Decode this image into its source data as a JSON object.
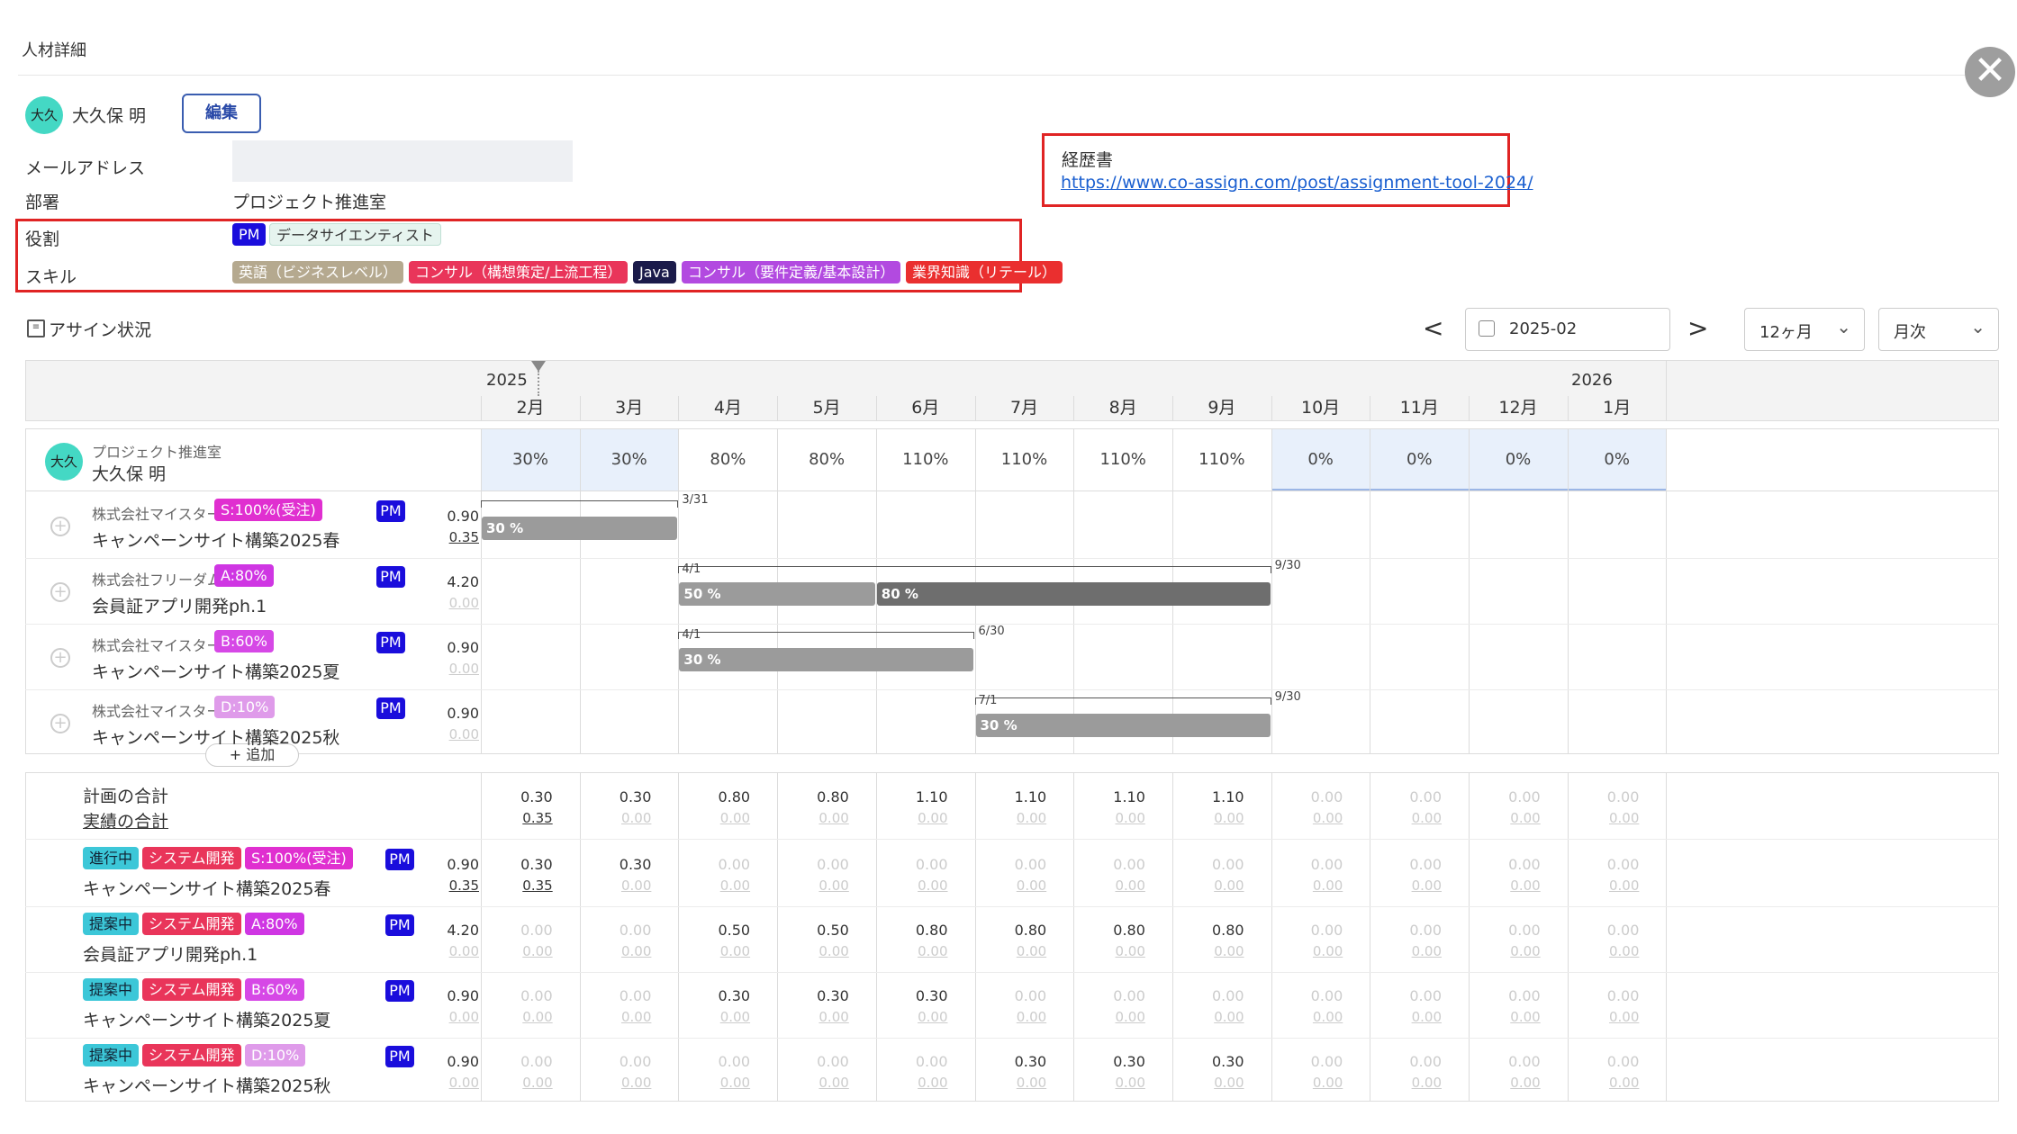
{
  "header": {
    "title": "人材詳細",
    "close_icon": "close-circle-icon"
  },
  "person": {
    "avatar": "大久",
    "name": "大久保 明",
    "edit_label": "編集"
  },
  "fields": {
    "email_label": "メールアドレス",
    "email_value": "",
    "dept_label": "部署",
    "dept_value": "プロジェクト推進室",
    "role_label": "役割",
    "skill_label": "スキル"
  },
  "roles": [
    {
      "label": "PM",
      "color": "#1a0ddc"
    },
    {
      "label": "データサイエンティスト",
      "color": "#e6f4ef"
    }
  ],
  "skills": [
    {
      "label": "英語（ビジネスレベル）",
      "color": "#b5a98f"
    },
    {
      "label": "コンサル（構想策定/上流工程）",
      "color": "#e9355a"
    },
    {
      "label": "Java",
      "color": "#1b1b4a"
    },
    {
      "label": "コンサル（要件定義/基本設計）",
      "color": "#b24ae0"
    },
    {
      "label": "業界知識（リテール）",
      "color": "#ea2f2f"
    }
  ],
  "resume": {
    "label": "経歴書",
    "url": "https://www.co-assign.com/post/assignment-tool-2024/"
  },
  "assign": {
    "title": "アサイン状況",
    "date": "2025-02",
    "period": "12ヶ月",
    "unit": "月次",
    "prev": "<",
    "next": ">"
  },
  "timeline": {
    "year_start": "2025",
    "year_end": "2026",
    "months": [
      "2月",
      "3月",
      "4月",
      "5月",
      "6月",
      "7月",
      "8月",
      "9月",
      "10月",
      "11月",
      "12月",
      "1月"
    ]
  },
  "summary_row": {
    "dept": "プロジェクト推進室",
    "name": "大久保 明",
    "avatar": "大久",
    "pcts": [
      "30%",
      "30%",
      "80%",
      "80%",
      "110%",
      "110%",
      "110%",
      "110%",
      "0%",
      "0%",
      "0%",
      "0%"
    ]
  },
  "assignments": [
    {
      "company": "株式会社マイスター",
      "tag": "S:100%(受注)",
      "tag_color": "#e02fd0",
      "project": "キャンペーンサイト構築2025春",
      "role": "PM",
      "plan": "0.90",
      "actual": "0.35",
      "range_end": "3/31",
      "bars": [
        {
          "label": "30 %",
          "start": 0,
          "end": 2
        }
      ]
    },
    {
      "company": "株式会社フリーダム",
      "tag": "A:80%",
      "tag_color": "#cf36e3",
      "project": "会員証アプリ開発ph.1",
      "role": "PM",
      "plan": "4.20",
      "actual": "0.00",
      "range_start": "4/1",
      "range_end": "9/30",
      "bars": [
        {
          "label": "50 %",
          "start": 2,
          "end": 4
        },
        {
          "label": "80 %",
          "start": 4,
          "end": 8
        }
      ]
    },
    {
      "company": "株式会社マイスター",
      "tag": "B:60%",
      "tag_color": "#d648e6",
      "project": "キャンペーンサイト構築2025夏",
      "role": "PM",
      "plan": "0.90",
      "actual": "0.00",
      "range_start": "4/1",
      "range_end": "6/30",
      "bars": [
        {
          "label": "30 %",
          "start": 2,
          "end": 5
        }
      ]
    },
    {
      "company": "株式会社マイスター",
      "tag": "D:10%",
      "tag_color": "#df9bea",
      "project": "キャンペーンサイト構築2025秋",
      "role": "PM",
      "plan": "0.90",
      "actual": "0.00",
      "range_start": "7/1",
      "range_end": "9/30",
      "bars": [
        {
          "label": "30 %",
          "start": 5,
          "end": 8
        }
      ]
    }
  ],
  "add_label": "+ 追加",
  "totals": {
    "plan_label": "計画の合計",
    "actual_label": "実績の合計",
    "plan": [
      "0.30",
      "0.30",
      "0.80",
      "0.80",
      "1.10",
      "1.10",
      "1.10",
      "1.10",
      "0.00",
      "0.00",
      "0.00",
      "0.00"
    ],
    "actual": [
      "0.35",
      "0.00",
      "0.00",
      "0.00",
      "0.00",
      "0.00",
      "0.00",
      "0.00",
      "0.00",
      "0.00",
      "0.00",
      "0.00"
    ]
  },
  "projects": [
    {
      "status": "進行中",
      "status_color": "#3cc7d8",
      "type": "システム開発",
      "type_color": "#e9355a",
      "tag": "S:100%(受注)",
      "tag_color": "#e02fd0",
      "name": "キャンペーンサイト構築2025春",
      "role": "PM",
      "plan_total": "0.90",
      "actual_total": "0.35",
      "plan": [
        "0.30",
        "0.30",
        "0.00",
        "0.00",
        "0.00",
        "0.00",
        "0.00",
        "0.00",
        "0.00",
        "0.00",
        "0.00",
        "0.00"
      ],
      "actual": [
        "0.35",
        "0.00",
        "0.00",
        "0.00",
        "0.00",
        "0.00",
        "0.00",
        "0.00",
        "0.00",
        "0.00",
        "0.00",
        "0.00"
      ]
    },
    {
      "status": "提案中",
      "status_color": "#3cc7d8",
      "type": "システム開発",
      "type_color": "#e9355a",
      "tag": "A:80%",
      "tag_color": "#cf36e3",
      "name": "会員証アプリ開発ph.1",
      "role": "PM",
      "plan_total": "4.20",
      "actual_total": "0.00",
      "plan": [
        "0.00",
        "0.00",
        "0.50",
        "0.50",
        "0.80",
        "0.80",
        "0.80",
        "0.80",
        "0.00",
        "0.00",
        "0.00",
        "0.00"
      ],
      "actual": [
        "0.00",
        "0.00",
        "0.00",
        "0.00",
        "0.00",
        "0.00",
        "0.00",
        "0.00",
        "0.00",
        "0.00",
        "0.00",
        "0.00"
      ]
    },
    {
      "status": "提案中",
      "status_color": "#3cc7d8",
      "type": "システム開発",
      "type_color": "#e9355a",
      "tag": "B:60%",
      "tag_color": "#d648e6",
      "name": "キャンペーンサイト構築2025夏",
      "role": "PM",
      "plan_total": "0.90",
      "actual_total": "0.00",
      "plan": [
        "0.00",
        "0.00",
        "0.30",
        "0.30",
        "0.30",
        "0.00",
        "0.00",
        "0.00",
        "0.00",
        "0.00",
        "0.00",
        "0.00"
      ],
      "actual": [
        "0.00",
        "0.00",
        "0.00",
        "0.00",
        "0.00",
        "0.00",
        "0.00",
        "0.00",
        "0.00",
        "0.00",
        "0.00",
        "0.00"
      ]
    },
    {
      "status": "提案中",
      "status_color": "#3cc7d8",
      "type": "システム開発",
      "type_color": "#e9355a",
      "tag": "D:10%",
      "tag_color": "#df9bea",
      "name": "キャンペーンサイト構築2025秋",
      "role": "PM",
      "plan_total": "0.90",
      "actual_total": "0.00",
      "plan": [
        "0.00",
        "0.00",
        "0.00",
        "0.00",
        "0.00",
        "0.30",
        "0.30",
        "0.30",
        "0.00",
        "0.00",
        "0.00",
        "0.00"
      ],
      "actual": [
        "0.00",
        "0.00",
        "0.00",
        "0.00",
        "0.00",
        "0.00",
        "0.00",
        "0.00",
        "0.00",
        "0.00",
        "0.00",
        "0.00"
      ]
    }
  ]
}
